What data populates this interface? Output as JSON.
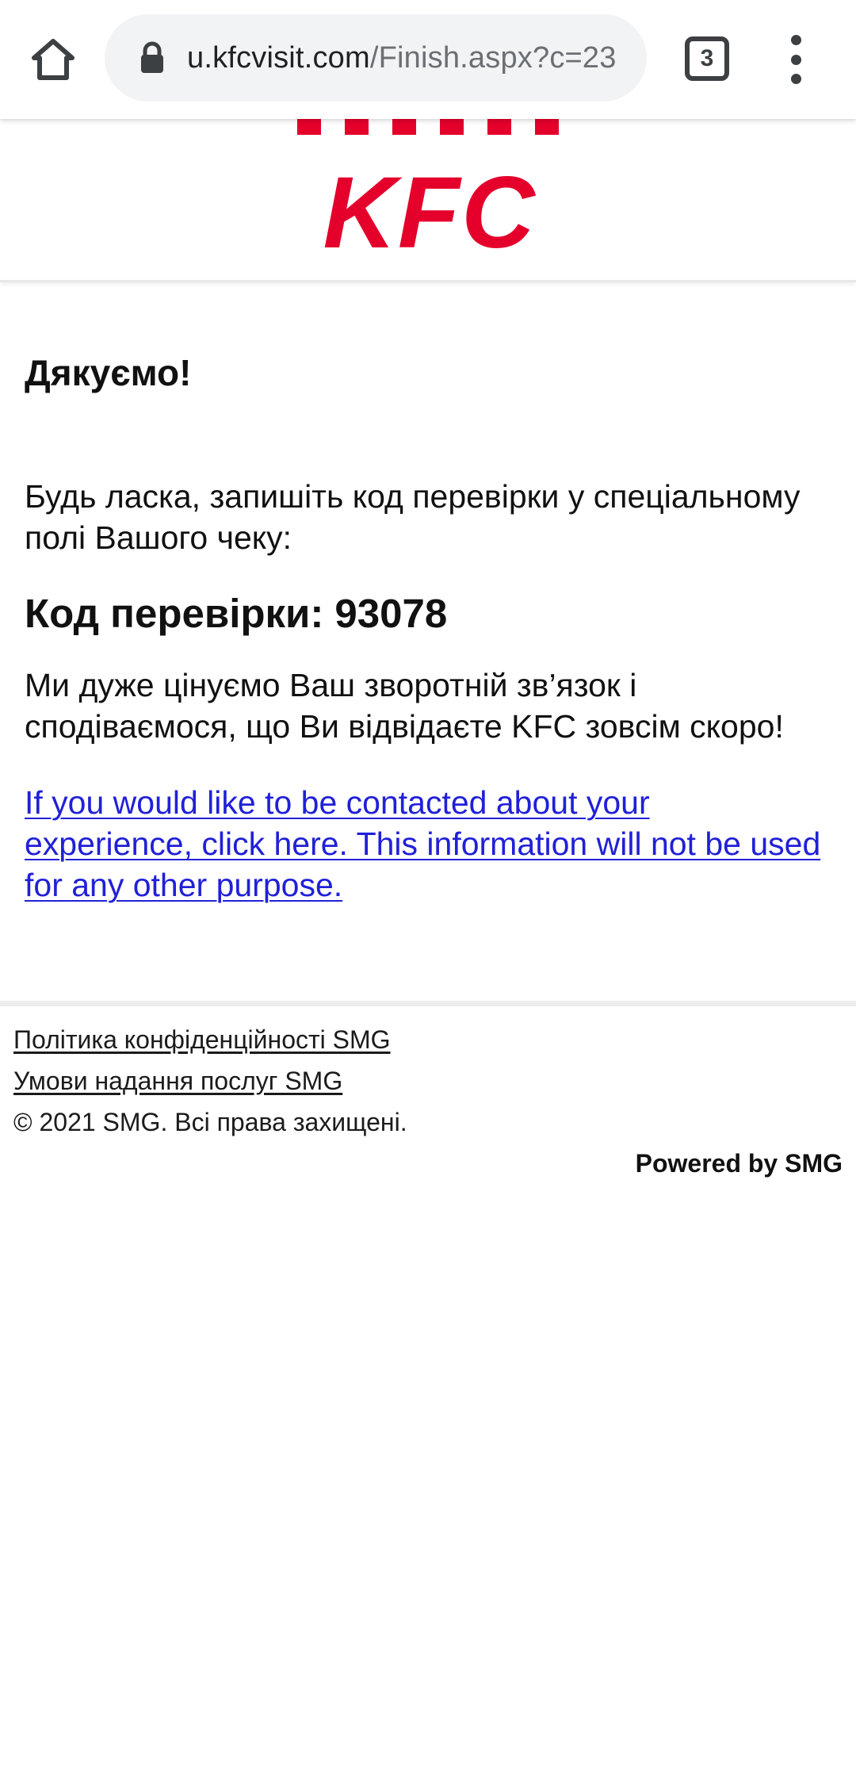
{
  "browser": {
    "url_host": "u.kfcvisit.com",
    "url_path": "/Finish.aspx?c=23",
    "tab_count": "3",
    "icons": [
      "home-icon",
      "lock-icon",
      "tab-switcher-icon",
      "overflow-menu-icon"
    ]
  },
  "header": {
    "logo_text": "KFC",
    "brand_color": "#e4002b"
  },
  "content": {
    "thanks": "Дякуємо!",
    "instruction": "Будь ласка, запишіть код перевірки у спеціальному полі Вашого чеку:",
    "code_label": "Код перевірки:",
    "code_value": "93078",
    "appreciation": "Ми дуже цінуємо Ваш зворотній зв’язок і сподіваємося, що Ви відвідаєте KFC зовсім скоро!",
    "contact_link": "If you would like to be contacted about your experience, click here. This information will not be used for any other purpose."
  },
  "footer": {
    "privacy_link": "Політика конфіденційності SMG",
    "terms_link": "Умови надання послуг SMG",
    "copyright": "© 2021 SMG. Всі права захищені.",
    "powered_by": "Powered by SMG"
  }
}
